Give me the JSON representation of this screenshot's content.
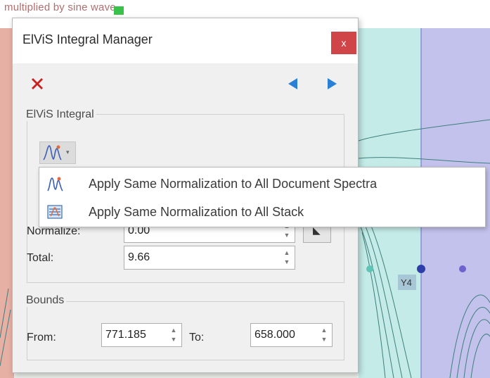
{
  "background": {
    "title_fragment": "multiplied by sine wave",
    "chart_label": "Y4"
  },
  "dialog": {
    "title": "ElViS Integral Manager",
    "close_label": "x",
    "icons": {
      "remove": "red-x-icon",
      "prev": "arrow-left-icon",
      "next": "arrow-right-icon",
      "normalize_menu": "spectrum-peak-icon",
      "stack": "stack-spectra-icon",
      "pick": "picker-icon"
    },
    "integral_group": {
      "label": "ElViS Integral",
      "normalize_label": "Normalize:",
      "normalize_value": "0.00",
      "total_label": "Total:",
      "total_value": "9.66"
    },
    "bounds_group": {
      "label": "Bounds",
      "from_label": "From:",
      "from_value": "771.185",
      "to_label": "To:",
      "to_value": "658.000"
    },
    "menu": {
      "items": [
        {
          "label": "Apply Same Normalization to All Document Spectra",
          "icon": "spectrum-peak-icon"
        },
        {
          "label": "Apply Same Normalization to All Stack",
          "icon": "stack-spectra-icon"
        }
      ]
    }
  },
  "colors": {
    "close": "#cf4548",
    "remove": "#c8201e",
    "nav_arrows": "#2a7fd6",
    "band_teal": "#c4ebe7",
    "band_lavender": "#c3c2ec"
  }
}
